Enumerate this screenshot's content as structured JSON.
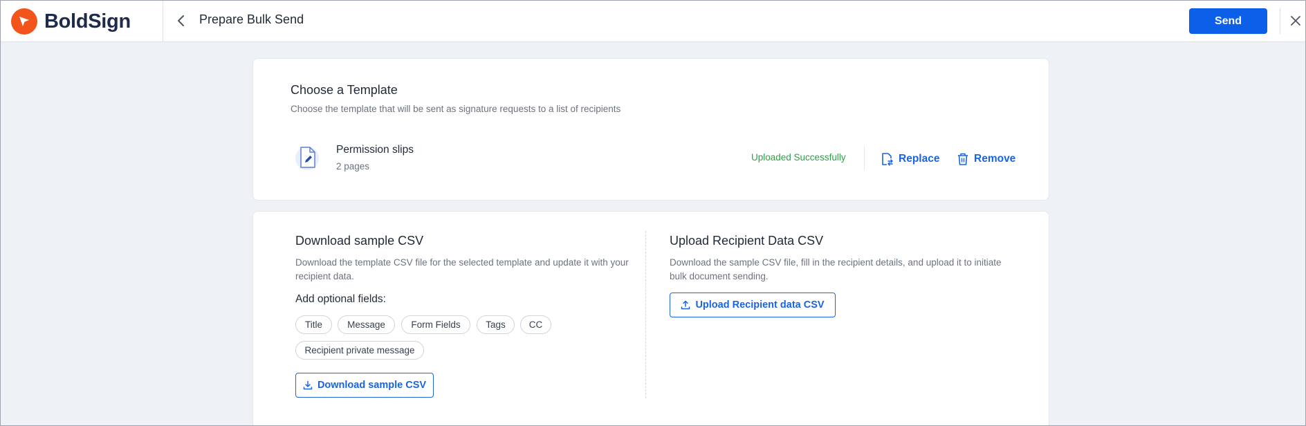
{
  "app": {
    "brand": "BoldSign",
    "brand_color": "#f2541b",
    "accent_color": "#0b5fe8"
  },
  "header": {
    "title": "Prepare Bulk Send",
    "back_icon": "chevron-left-icon",
    "send_label": "Send",
    "close_icon": "close-icon"
  },
  "template_section": {
    "title": "Choose a Template",
    "description": "Choose the template that will be sent as signature requests to a list of recipients",
    "file": {
      "name": "Permission slips",
      "pages": "2 pages",
      "icon": "document-edit-icon"
    },
    "status": "Uploaded Successfully",
    "status_color": "#27a346",
    "replace_label": "Replace",
    "remove_label": "Remove"
  },
  "download_section": {
    "title": "Download sample CSV",
    "description": "Download the template CSV file for the selected template and update it with your recipient data.",
    "optional_label": "Add optional fields:",
    "chips": [
      "Title",
      "Message",
      "Form Fields",
      "Tags",
      "CC",
      "Recipient private message"
    ],
    "button_label": "Download sample CSV"
  },
  "upload_section": {
    "title": "Upload Recipient Data CSV",
    "description": "Download the sample CSV file, fill in the recipient details, and upload it to initiate bulk document sending.",
    "button_label": "Upload Recipient data CSV"
  }
}
